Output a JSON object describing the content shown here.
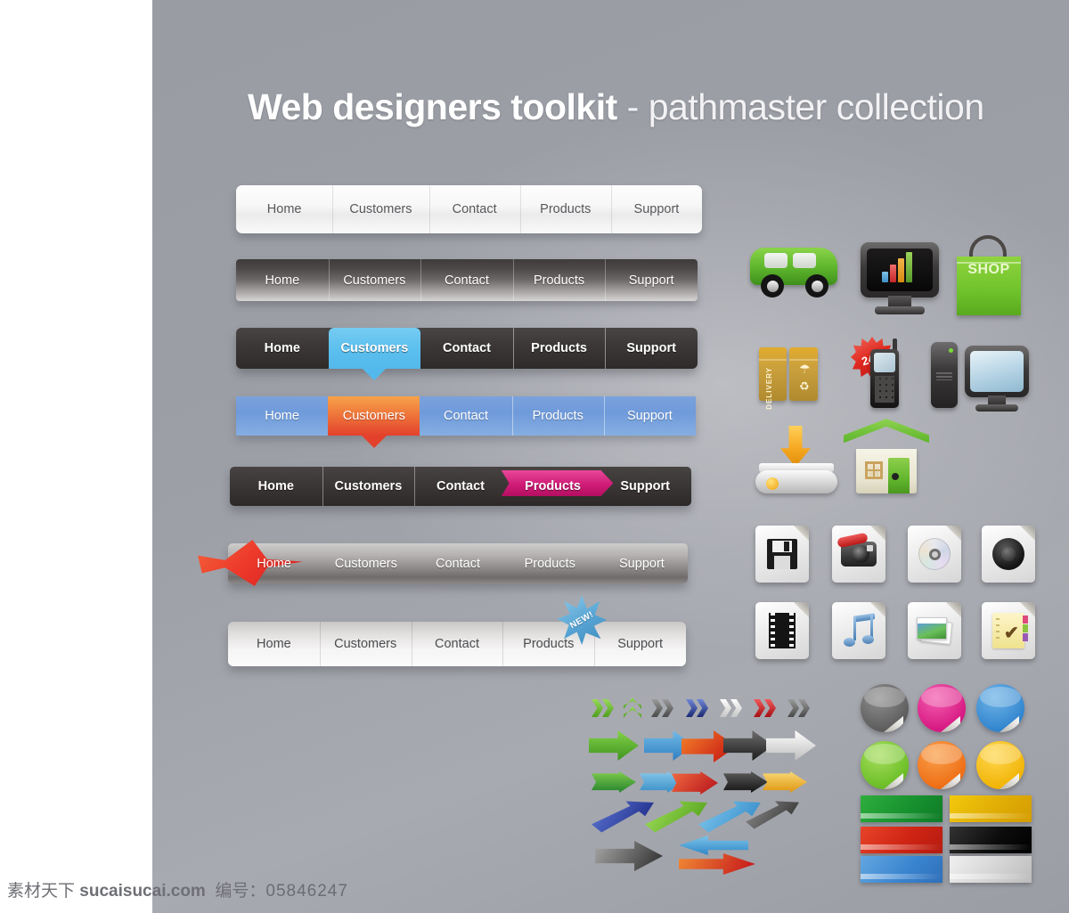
{
  "page": {
    "title_bold": "Web designers toolkit",
    "title_light": " - pathmaster collection",
    "background_color": "#9d9fa7"
  },
  "navbars": [
    {
      "id": "nav1",
      "style": "white-glossy",
      "items": [
        "Home",
        "Customers",
        "Contact",
        "Products",
        "Support"
      ],
      "active_index": -1
    },
    {
      "id": "nav2",
      "style": "dark-to-silver",
      "items": [
        "Home",
        "Customers",
        "Contact",
        "Products",
        "Support"
      ],
      "active_index": -1
    },
    {
      "id": "nav3",
      "style": "dark-with-blue-active",
      "items": [
        "Home",
        "Customers",
        "Contact",
        "Products",
        "Support"
      ],
      "active_index": 1,
      "active_color": "#53b9ec"
    },
    {
      "id": "nav4",
      "style": "blue-with-orange-active",
      "items": [
        "Home",
        "Customers",
        "Contact",
        "Products",
        "Support"
      ],
      "active_index": 1,
      "active_color": "#e3412c",
      "bar_color": "#6f9ada"
    },
    {
      "id": "nav5",
      "style": "dark-with-magenta-ribbon",
      "items": [
        "Home",
        "Customers",
        "Contact",
        "Products",
        "Support"
      ],
      "active_index": 3,
      "active_color": "#d01c76"
    },
    {
      "id": "nav6",
      "style": "silver-with-red-burst",
      "items": [
        "Home",
        "Customers",
        "Contact",
        "Products",
        "Support"
      ],
      "active_index": 0,
      "active_color": "#ed3a2b"
    },
    {
      "id": "nav7",
      "style": "light-silver-with-new-badge",
      "items": [
        "Home",
        "Customers",
        "Contact",
        "Products",
        "Support"
      ],
      "active_index": -1,
      "badge_index": 3,
      "badge_label": "NEW!",
      "badge_color": "#5aa7d6"
    }
  ],
  "icons": {
    "van_label": "van-icon",
    "monitor_label": "monitor-chart-icon",
    "shop_bag_text": "SHOP",
    "delivery_box_text": "DELIVERY",
    "phone_badge_text": "24H",
    "computer_label": "desktop-computer-icon",
    "download_label": "download-icon",
    "house_label": "house-icon",
    "file_icons": [
      "save-floppy-icon",
      "camera-icon",
      "cd-disc-icon",
      "speaker-icon",
      "film-strip-icon",
      "music-note-icon",
      "photo-icon",
      "checklist-notepad-icon"
    ],
    "notepad_check": "✔"
  },
  "chevron_colors": [
    "#72c43b",
    "#72c43b",
    "#6e6e6e",
    "#2b3f8f",
    "#e6e6e6",
    "#cf1f25",
    "#5e5e5e"
  ],
  "arrow_row1_colors": [
    "#5bb82e",
    "#4a9ede",
    "#e0492a",
    "#3b3b3b",
    "#d9d9d9"
  ],
  "arrow_row2_colors": [
    "#3fa844",
    "#55a7dd",
    "#d4252a",
    "#2e2e2e",
    "#e8a928"
  ],
  "arrow_diag_colors": [
    "#2b3f9e",
    "#76c62f",
    "#49a7e0",
    "#4a4a4a"
  ],
  "arrow_bottom_colors": [
    "#4a4a4a",
    "#4aa3dc",
    "#d92a2a"
  ],
  "stickers": [
    {
      "name": "sticker-gray",
      "color": "#6f6f6f"
    },
    {
      "name": "sticker-pink",
      "color": "#e0248e"
    },
    {
      "name": "sticker-blue",
      "color": "#3d92d8"
    },
    {
      "name": "sticker-green",
      "color": "#7bc931"
    },
    {
      "name": "sticker-orange",
      "color": "#f07820"
    },
    {
      "name": "sticker-yellow",
      "color": "#f5c01a"
    }
  ],
  "banners": [
    {
      "name": "banner-green",
      "color": "#1e9e34"
    },
    {
      "name": "banner-yellow",
      "color": "#e9bf08"
    },
    {
      "name": "banner-red",
      "color": "#d62a18"
    },
    {
      "name": "banner-black",
      "color": "#111111"
    },
    {
      "name": "banner-blue",
      "color": "#3f8cd4"
    },
    {
      "name": "banner-silver",
      "color": "#d8d8d8"
    }
  ],
  "footer": {
    "site_cn": "素材天下",
    "site_domain": "sucaisucai.com",
    "id_label": "编号：",
    "id_value": "05846247"
  }
}
